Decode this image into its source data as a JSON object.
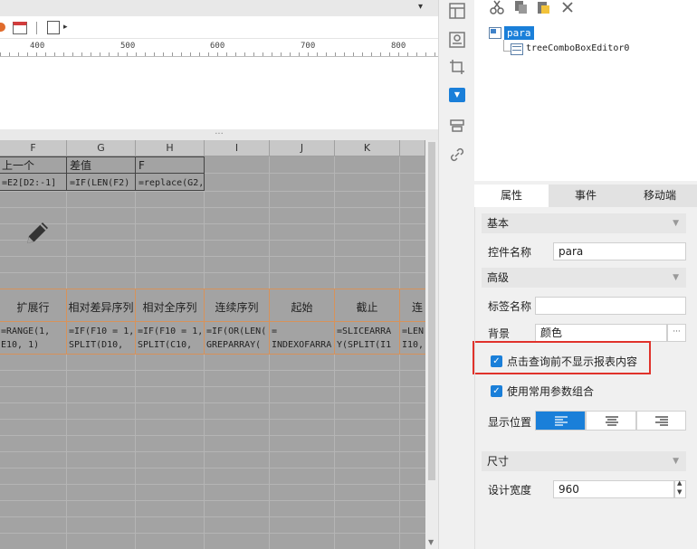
{
  "ruler": {
    "labels": [
      "400",
      "500",
      "600",
      "700",
      "800"
    ]
  },
  "splitter": {
    "grip": "..."
  },
  "grid": {
    "columns": [
      "F",
      "G",
      "H",
      "I",
      "J",
      "K"
    ],
    "row1": {
      "f": "上一个",
      "g": "差值",
      "h": "F"
    },
    "row2": {
      "f": "=E2[D2:-1]",
      "g": "=IF(LEN(F2)",
      "h": "=replace(G2,"
    },
    "headers": [
      "扩展行",
      "相对差异序列",
      "相对全序列",
      "连续序列",
      "起始",
      "截止",
      "连"
    ],
    "formulas": {
      "f": [
        "=RANGE(1,",
        "E10, 1)"
      ],
      "g": [
        "=IF(F10 = 1,",
        " SPLIT(D10,"
      ],
      "h": [
        "=IF(F10 = 1,",
        " SPLIT(C10,"
      ],
      "i": [
        "=IF(OR(LEN(",
        "GREPARRAY("
      ],
      "j": [
        "=",
        "INDEXOFARRA"
      ],
      "k": [
        "=SLICEARRA",
        "Y(SPLIT(I1"
      ],
      "l": [
        "=LEN",
        "I10,"
      ]
    }
  },
  "tree": {
    "root": "para",
    "child": "treeComboBoxEditor0"
  },
  "tabs": [
    "属性",
    "事件",
    "移动端"
  ],
  "props": {
    "basic_title": "基本",
    "control_name_label": "控件名称",
    "control_name_value": "para",
    "advanced_title": "高级",
    "tag_name_label": "标签名称",
    "tag_name_value": "",
    "background_label": "背景",
    "background_value": "颜色",
    "more_button": "···",
    "checkbox1": "点击查询前不显示报表内容",
    "checkbox2": "使用常用参数组合",
    "display_pos_label": "显示位置",
    "size_title": "尺寸",
    "design_width_label": "设计宽度",
    "design_width_value": "960"
  },
  "colors": {
    "accent": "#1a7fd9",
    "highlight": "#e0322b",
    "grid_bg": "#a3a3a3"
  }
}
